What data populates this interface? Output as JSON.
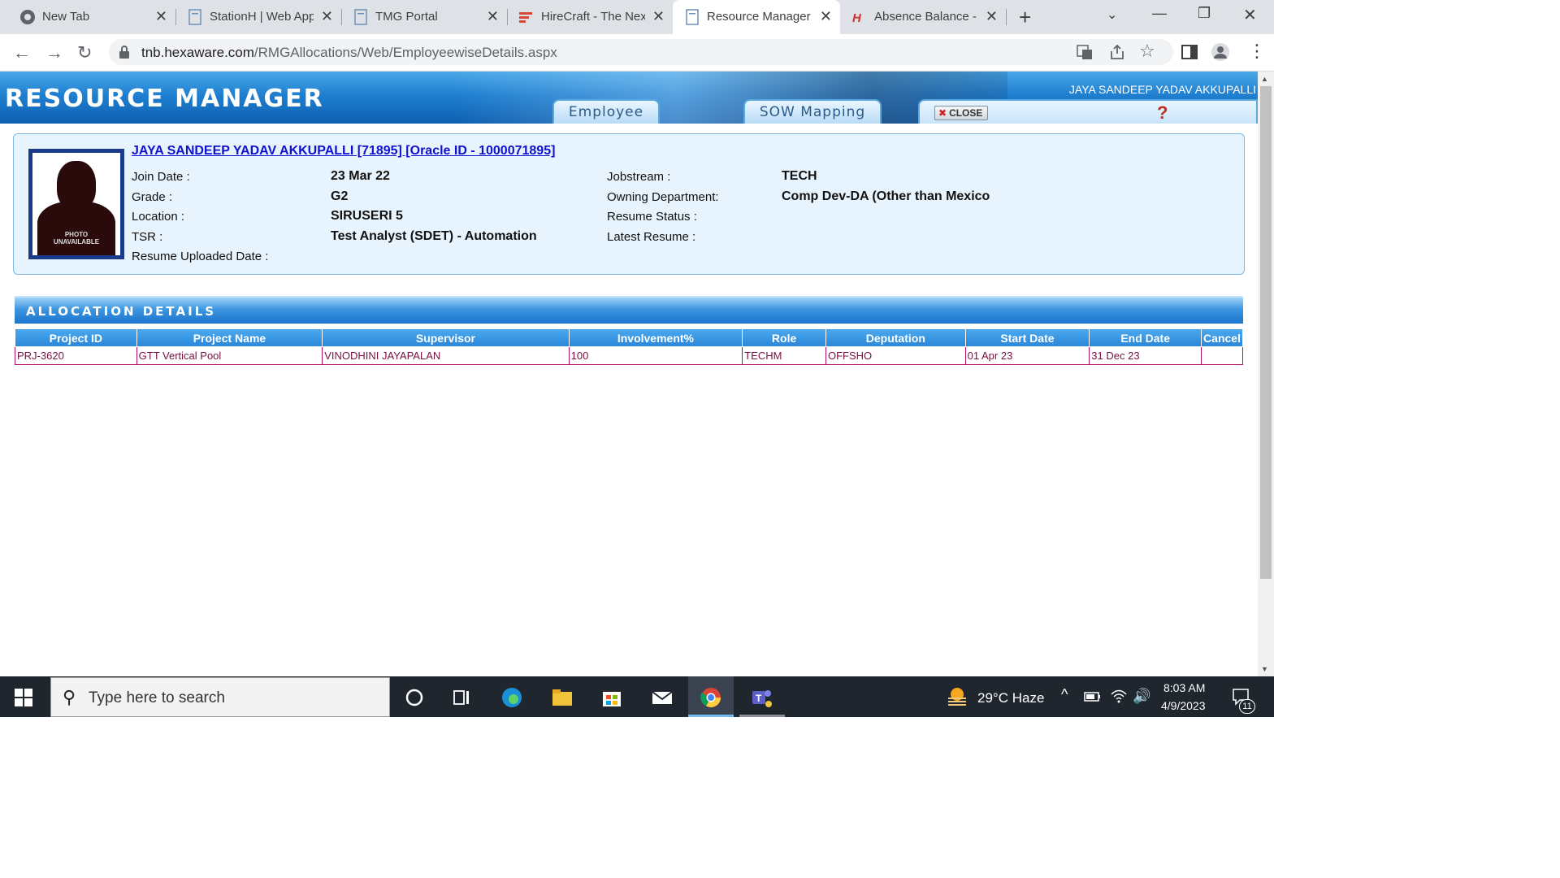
{
  "browser": {
    "tabs": [
      {
        "label": "New Tab",
        "icon": "chrome-icon",
        "active": false
      },
      {
        "label": "StationH | Web App",
        "icon": "page-icon",
        "active": false
      },
      {
        "label": "TMG Portal",
        "icon": "page-icon",
        "active": false
      },
      {
        "label": "HireCraft - The Nex",
        "icon": "hirecraft-icon",
        "active": false
      },
      {
        "label": "Resource Manager",
        "icon": "page-icon",
        "active": true
      },
      {
        "label": "Absence Balance - ",
        "icon": "hi-icon",
        "active": false
      }
    ],
    "new_tab_symbol": "+",
    "url_host": "tnb.hexaware.com",
    "url_path": "/RMGAllocations/Web/EmployeewiseDetails.aspx"
  },
  "banner": {
    "title": "RESOURCE MANAGER",
    "user": "JAYA SANDEEP YADAV AKKUPALLI",
    "tabs": [
      "Employee",
      "SOW Mapping"
    ],
    "close_label": "CLOSE",
    "help_symbol": "?"
  },
  "employee": {
    "name_link": "JAYA SANDEEP YADAV AKKUPALLI [71895] [Oracle ID - 1000071895]",
    "photo_text_1": "PHOTO",
    "photo_text_2": "UNAVAILABLE",
    "fields_left": [
      {
        "label": "Join Date :",
        "value": "23 Mar 22"
      },
      {
        "label": "Grade :",
        "value": "G2"
      },
      {
        "label": "Location :",
        "value": "SIRUSERI 5"
      },
      {
        "label": "TSR :",
        "value": "Test Analyst (SDET) - Automation"
      },
      {
        "label": "Resume Uploaded Date :",
        "value": ""
      }
    ],
    "fields_right": [
      {
        "label": "Jobstream :",
        "value": "TECH"
      },
      {
        "label": "Owning Department:",
        "value": "Comp Dev-DA (Other than Mexico"
      },
      {
        "label": "Resume Status :",
        "value": ""
      },
      {
        "label": "Latest Resume :",
        "value": ""
      }
    ]
  },
  "allocation": {
    "title": "ALLOCATION DETAILS",
    "columns": [
      "Project ID",
      "Project Name",
      "Supervisor",
      "Involvement%",
      "Role",
      "Deputation",
      "Start Date",
      "End Date",
      "Cancel"
    ],
    "rows": [
      [
        "PRJ-3620",
        "GTT Vertical Pool",
        "VINODHINI JAYAPALAN",
        "100",
        "TECHM",
        "OFFSHO",
        "01 Apr 23",
        "31 Dec 23",
        ""
      ]
    ]
  },
  "taskbar": {
    "search_placeholder": "Type here to search",
    "weather": "29°C  Haze",
    "time": "8:03 AM",
    "date": "4/9/2023",
    "notification_count": "11"
  }
}
